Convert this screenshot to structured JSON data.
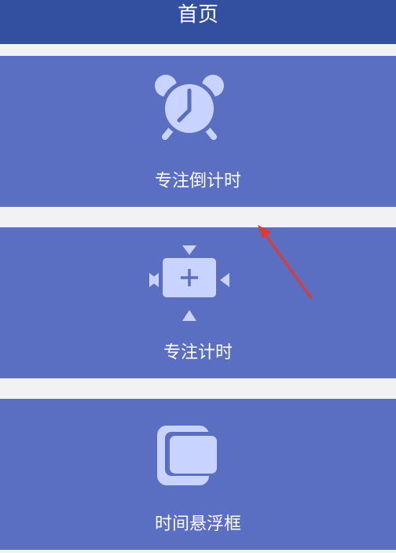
{
  "header": {
    "title": "首页"
  },
  "cards": [
    {
      "label": "专注倒计时",
      "icon": "alarm-clock-icon"
    },
    {
      "label": "专注计时",
      "icon": "expand-plus-icon"
    },
    {
      "label": "时间悬浮框",
      "icon": "floating-window-icon"
    }
  ],
  "colors": {
    "header_bg": "#334fa0",
    "card_bg": "#5a6ec2",
    "icon": "#c9d3ff",
    "page_bg": "#f2f2f4",
    "annotation_arrow": "#e23a2e"
  }
}
